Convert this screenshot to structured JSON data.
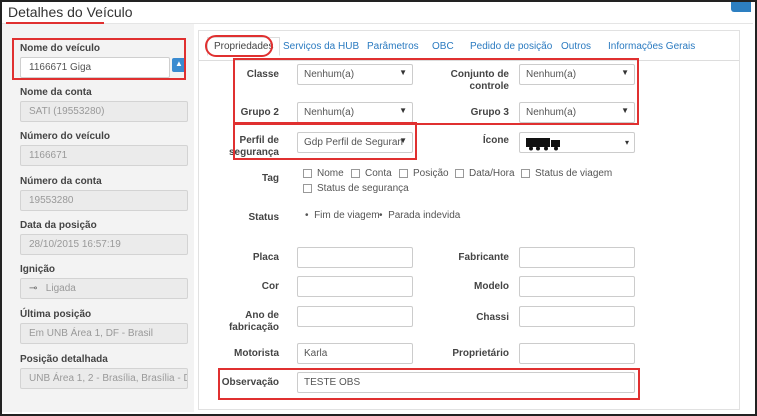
{
  "header": {
    "title": "Detalhes do Veículo"
  },
  "left_panel": {
    "collapse_glyph": "▲",
    "fields": [
      {
        "label": "Nome do veículo",
        "value": "1166671 Giga",
        "editable": true
      },
      {
        "label": "Nome da conta",
        "value": "SATI (19553280)"
      },
      {
        "label": "Número do veículo",
        "value": "1166671"
      },
      {
        "label": "Número da conta",
        "value": "19553280"
      },
      {
        "label": "Data da posição",
        "value": "28/10/2015 16:57:19"
      },
      {
        "label": "Ignição",
        "value": "Ligada",
        "icon": "key-icon"
      },
      {
        "label": "Última posição",
        "value": "Em  UNB Área 1, DF - Brasil"
      },
      {
        "label": "Posição detalhada",
        "value": "UNB Área 1, 2 - Brasília, Brasília - DF, E"
      }
    ]
  },
  "tabs": [
    {
      "label": "Propriedades",
      "active": true
    },
    {
      "label": "Serviços da HUB"
    },
    {
      "label": "Parâmetros"
    },
    {
      "label": "OBC"
    },
    {
      "label": "Pedido de posição"
    },
    {
      "label": "Outros"
    },
    {
      "label": "Informações Gerais"
    }
  ],
  "form": {
    "classe": {
      "label": "Classe",
      "value": "Nenhum(a)"
    },
    "conjunto": {
      "label": "Conjunto de controle",
      "value": "Nenhum(a)"
    },
    "grupo2": {
      "label": "Grupo 2",
      "value": "Nenhum(a)"
    },
    "grupo3": {
      "label": "Grupo 3",
      "value": "Nenhum(a)"
    },
    "perfil": {
      "label": "Perfil de segurança",
      "value": "Gdp Perfil de Seguran"
    },
    "icone": {
      "label": "Ícone",
      "icon": "truck-icon"
    },
    "tag": {
      "label": "Tag",
      "options": [
        "Nome",
        "Conta",
        "Posição",
        "Data/Hora",
        "Status de viagem",
        "Status de segurança"
      ]
    },
    "status": {
      "label": "Status",
      "items": [
        "Fim de viagem",
        "Parada indevida"
      ]
    },
    "placa": {
      "label": "Placa",
      "value": ""
    },
    "fabricante": {
      "label": "Fabricante",
      "value": ""
    },
    "cor": {
      "label": "Cor",
      "value": ""
    },
    "modelo": {
      "label": "Modelo",
      "value": ""
    },
    "ano": {
      "label": "Ano de fabricação",
      "value": ""
    },
    "chassi": {
      "label": "Chassi",
      "value": ""
    },
    "motorista": {
      "label": "Motorista",
      "value": "Karla"
    },
    "proprietario": {
      "label": "Proprietário",
      "value": ""
    },
    "observacao": {
      "label": "Observação",
      "value": "TESTE OBS"
    }
  },
  "colors": {
    "accent": "#2a7ac0",
    "highlight": "#e03030"
  }
}
